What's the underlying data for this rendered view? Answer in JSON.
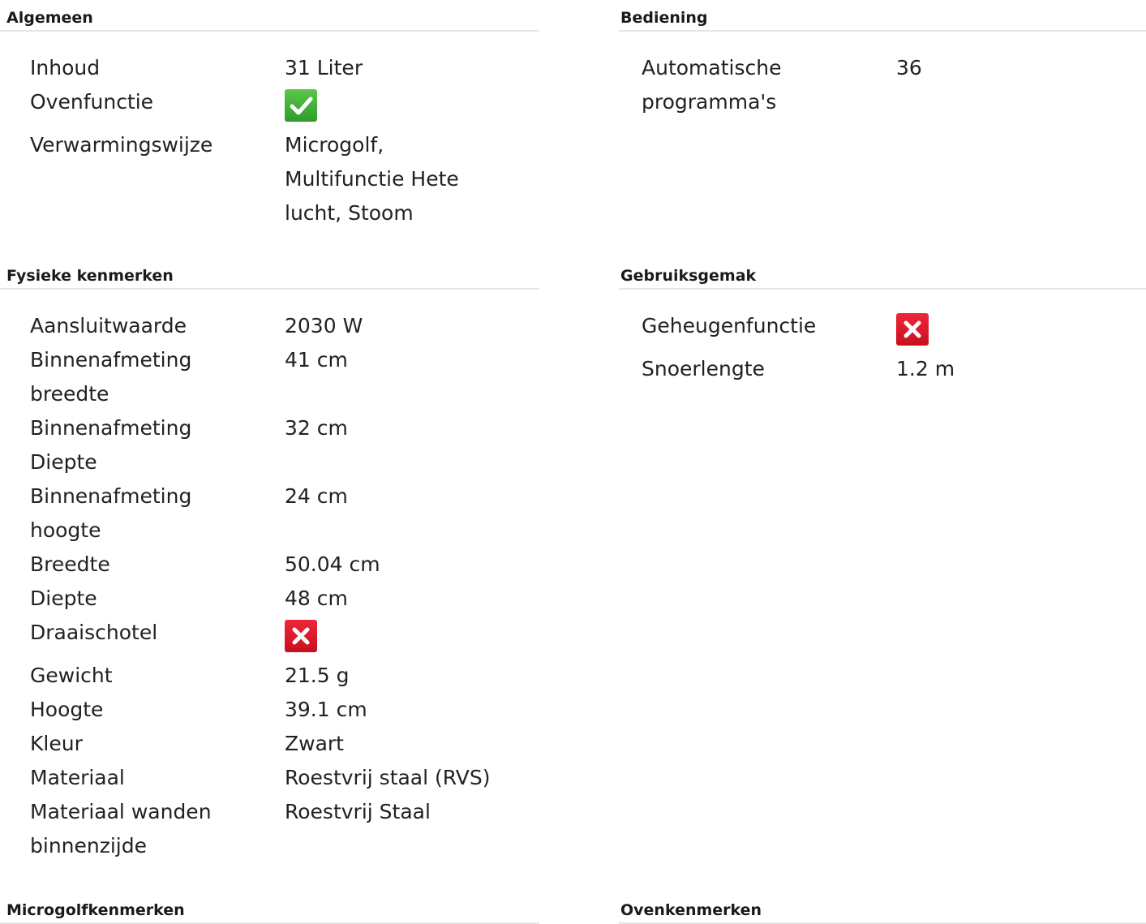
{
  "left": {
    "algemeen": {
      "title": "Algemeen",
      "rows": [
        {
          "label": "Inhoud",
          "value": "31 Liter"
        },
        {
          "label": "Ovenfunctie",
          "icon": "check-icon"
        },
        {
          "label": "Verwarmingswijze",
          "value": "Microgolf, Multifunctie Hete lucht, Stoom"
        }
      ]
    },
    "fysieke": {
      "title": "Fysieke kenmerken",
      "rows": [
        {
          "label": "Aansluitwaarde",
          "value": "2030 W"
        },
        {
          "label": "Binnenafmeting breedte",
          "value": "41 cm"
        },
        {
          "label": "Binnenafmeting Diepte",
          "value": "32 cm"
        },
        {
          "label": "Binnenafmeting hoogte",
          "value": "24 cm"
        },
        {
          "label": "Breedte",
          "value": "50.04 cm"
        },
        {
          "label": "Diepte",
          "value": "48 cm"
        },
        {
          "label": "Draaischotel",
          "icon": "cross-icon"
        },
        {
          "label": "Gewicht",
          "value": "21.5 g"
        },
        {
          "label": "Hoogte",
          "value": "39.1 cm"
        },
        {
          "label": "Kleur",
          "value": "Zwart"
        },
        {
          "label": "Materiaal",
          "value": "Roestvrij staal (RVS)"
        },
        {
          "label": "Materiaal wanden binnenzijde",
          "value": "Roestvrij Staal"
        }
      ]
    },
    "microgolf": {
      "title": "Microgolfkenmerken"
    }
  },
  "right": {
    "bediening": {
      "title": "Bediening",
      "rows": [
        {
          "label": "Automatische programma's",
          "value": "36"
        }
      ]
    },
    "gebruiksgemak": {
      "title": "Gebruiksgemak",
      "rows": [
        {
          "label": "Geheugenfunctie",
          "icon": "cross-icon"
        },
        {
          "label": "Snoerlengte",
          "value": "1.2 m"
        }
      ]
    },
    "ovenkenmerken": {
      "title": "Ovenkenmerken"
    }
  },
  "colors": {
    "check": "#3fae34",
    "cross": "#e21b2c",
    "divider": "#e5e5e5"
  }
}
